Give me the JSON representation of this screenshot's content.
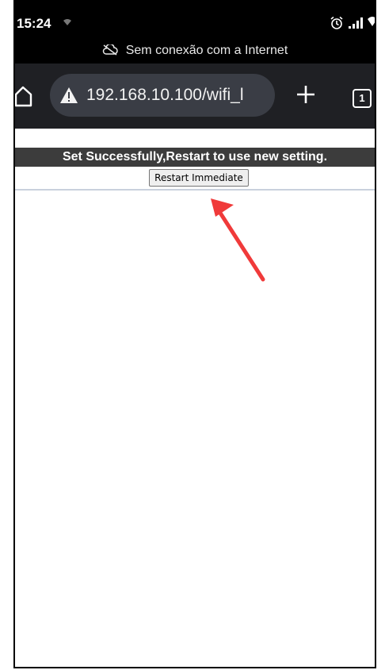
{
  "status_bar": {
    "time": "15:24",
    "wifi_icon": "wifi-icon",
    "alarm_icon": "alarm-icon",
    "signal_icon": "signal-icon"
  },
  "offline_banner": {
    "icon": "cloud-off-icon",
    "text": "Sem conexão com a Internet"
  },
  "browser": {
    "url": "192.168.10.100/wifi_l",
    "tab_count": "1",
    "colors": {
      "toolbar": "#1f2024",
      "urlbar": "#3a3d45"
    }
  },
  "page": {
    "message": "Set Successfully,Restart to use new setting.",
    "restart_button": "Restart Immediate",
    "colors": {
      "message_bg": "#3c3c3c",
      "annotation_arrow": "#f03a3a"
    }
  }
}
